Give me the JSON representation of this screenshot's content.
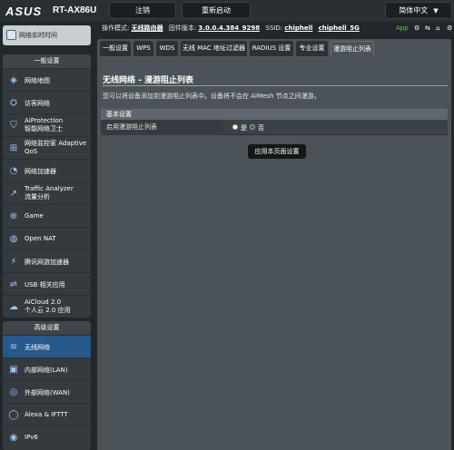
{
  "header": {
    "brand": "ASUS",
    "model": "RT-AX86U",
    "logout_label": "注销",
    "reboot_label": "重新启动",
    "language_label": "简体中文",
    "language_arrow": "▼"
  },
  "status": {
    "mode_label": "操作模式:",
    "mode_value": "无线路由器",
    "firmware_label": "固件版本:",
    "firmware_value": "3.0.0.4.384_9298",
    "ssid_label": "SSID:",
    "ssid_1": "chiphell",
    "ssid_2": "chiphell_5G",
    "app_label": "App",
    "icons": [
      "gear-icon",
      "usb-icon",
      "network-icon",
      "gear-icon"
    ]
  },
  "sidebar": {
    "top_item": "网络实时时间",
    "general_title": "一般设置",
    "general_items": [
      {
        "icon": "map-icon",
        "label": "网络地图"
      },
      {
        "icon": "guest-icon",
        "label": "访客网络"
      },
      {
        "icon": "shield-icon",
        "label": "AiProtection",
        "label2": "智能网络卫士"
      },
      {
        "icon": "qos-icon",
        "label": "网络监控家 Adaptive",
        "label2": "QoS"
      },
      {
        "icon": "speed-icon",
        "label": "网络加速器"
      },
      {
        "icon": "chart-icon",
        "label": "Traffic Analyzer",
        "label2": "流量分析"
      },
      {
        "icon": "gamepad-icon",
        "label": "Game"
      },
      {
        "icon": "globe-icon",
        "label": "Open NAT"
      },
      {
        "icon": "accelerator-icon",
        "label": "腾讯网游加速器"
      },
      {
        "icon": "usb-icon",
        "label": "USB 相关应用"
      },
      {
        "icon": "cloud-icon",
        "label": "AiCloud 2.0",
        "label2": "个人云 2.0 应用"
      }
    ],
    "advanced_title": "高级设置",
    "advanced_items": [
      {
        "icon": "wifi-icon",
        "label": "无线网络"
      },
      {
        "icon": "lan-icon",
        "label": "内部网络(LAN)"
      },
      {
        "icon": "wan-icon",
        "label": "外部网络(WAN)"
      },
      {
        "icon": "alexa-icon",
        "label": "Alexa & IFTTT"
      },
      {
        "icon": "ipv6-icon",
        "label": "IPv6"
      }
    ]
  },
  "tabs": [
    "一般设置",
    "WPS",
    "WDS",
    "无线 MAC 地址过滤器",
    "RADIUS 设置",
    "专业设置",
    "漫游阻止列表"
  ],
  "main": {
    "title": "无线网络 - 漫游阻止列表",
    "description": "您可以将设备添加到漫游阻止列表中。设备将不会在 AiMesh 节点之间漫游。",
    "section_title": "基本设置",
    "row_label": "启用漫游阻止列表",
    "option_yes": "是",
    "option_no": "否",
    "apply_label": "应用本页面设置"
  }
}
